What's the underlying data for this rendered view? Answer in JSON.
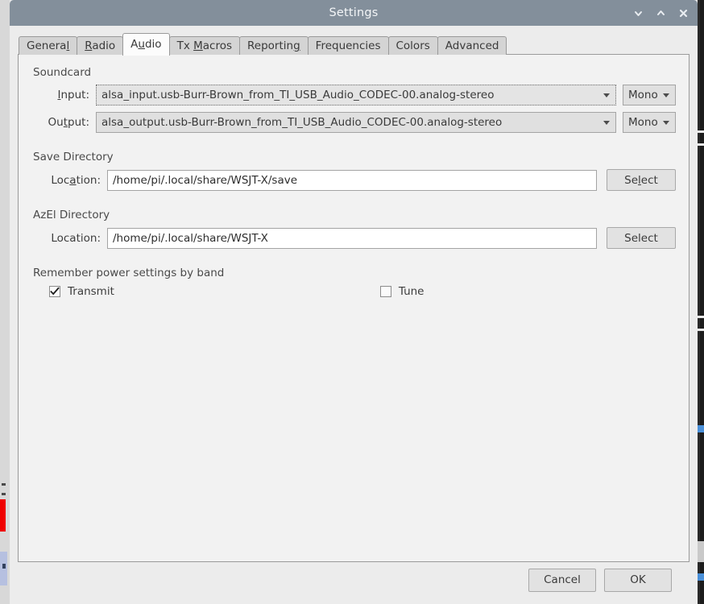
{
  "window": {
    "title": "Settings",
    "controls": [
      {
        "name": "minimize",
        "glyph": "chevron-down"
      },
      {
        "name": "maximize",
        "glyph": "chevron-up"
      },
      {
        "name": "close",
        "glyph": "x"
      }
    ]
  },
  "tabs": [
    {
      "label": "General",
      "pre": "Genera",
      "acc": "l",
      "post": "",
      "selected": false
    },
    {
      "label": "Radio",
      "pre": "",
      "acc": "R",
      "post": "adio",
      "selected": false
    },
    {
      "label": "Audio",
      "pre": "A",
      "acc": "u",
      "post": "dio",
      "selected": true
    },
    {
      "label": "Tx Macros",
      "pre": "Tx ",
      "acc": "M",
      "post": "acros",
      "selected": false
    },
    {
      "label": "Reporting",
      "pre": "Reportin",
      "acc": "g",
      "post": "",
      "selected": false
    },
    {
      "label": "Frequencies",
      "pre": "Frequencies",
      "acc": "",
      "post": "",
      "selected": false
    },
    {
      "label": "Colors",
      "pre": "Colors",
      "acc": "",
      "post": "",
      "selected": false
    },
    {
      "label": "Advanced",
      "pre": "Advanced",
      "acc": "",
      "post": "",
      "selected": false
    }
  ],
  "soundcard": {
    "group_label": "Soundcard",
    "input": {
      "label_pre": "",
      "label_acc": "I",
      "label_post": "nput:",
      "device": "alsa_input.usb-Burr-Brown_from_TI_USB_Audio_CODEC-00.analog-stereo",
      "channel": "Mono"
    },
    "output": {
      "label_pre": "Ou",
      "label_acc": "t",
      "label_post": "put:",
      "device": "alsa_output.usb-Burr-Brown_from_TI_USB_Audio_CODEC-00.analog-stereo",
      "channel": "Mono"
    }
  },
  "save_directory": {
    "group_label": "Save Directory",
    "label_pre": "Loc",
    "label_acc": "a",
    "label_post": "tion:",
    "path": "/home/pi/.local/share/WSJT-X/save",
    "button_pre": "Se",
    "button_acc": "l",
    "button_post": "ect"
  },
  "azel_directory": {
    "group_label": "AzEl Directory",
    "label_pre": "Location:",
    "label_acc": "",
    "label_post": "",
    "path": "/home/pi/.local/share/WSJT-X",
    "button_pre": "Select",
    "button_acc": "",
    "button_post": ""
  },
  "power_settings": {
    "group_label": "Remember power settings by band",
    "transmit": {
      "label": "Transmit",
      "checked": true
    },
    "tune": {
      "label": "Tune",
      "checked": false
    }
  },
  "footer": {
    "cancel": "Cancel",
    "ok": "OK"
  },
  "colors": {
    "titlebar": "#838f9b",
    "window_bg": "#ececec",
    "page_bg": "#f2f2f2",
    "tab_bg": "#d4d4d4",
    "tab_selected_bg": "#fcfcfc",
    "border": "#9a9a9a",
    "field_bg": "#ffffff",
    "combo_bg": "#e0e0e0",
    "text": "#3a3a3a"
  }
}
